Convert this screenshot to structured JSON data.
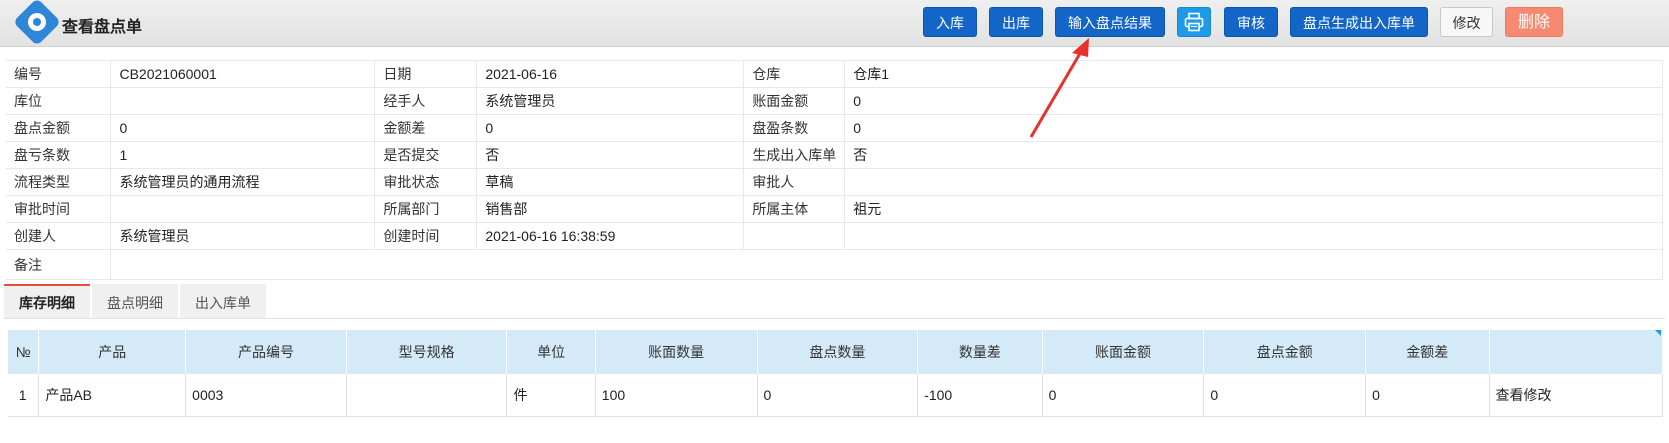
{
  "header": {
    "title": "查看盘点单",
    "buttons": {
      "in_stock": "入库",
      "out_stock": "出库",
      "input_result": "输入盘点结果",
      "audit": "审核",
      "generate": "盘点生成出入库单",
      "edit": "修改",
      "delete": "删除"
    },
    "icons": {
      "logo": "eye-logo-icon",
      "print": "printer-icon"
    },
    "colors": {
      "primary": "#1366c8",
      "print": "#1d9be8",
      "delete": "#f68a71",
      "annotation": "#e8312a"
    }
  },
  "info": {
    "rows": [
      [
        {
          "l": "编号",
          "v": "CB2021060001"
        },
        {
          "l": "日期",
          "v": "2021-06-16"
        },
        {
          "l": "仓库",
          "v": "仓库1"
        }
      ],
      [
        {
          "l": "库位",
          "v": ""
        },
        {
          "l": "经手人",
          "v": "系统管理员"
        },
        {
          "l": "账面金额",
          "v": "0"
        }
      ],
      [
        {
          "l": "盘点金额",
          "v": "0"
        },
        {
          "l": "金额差",
          "v": "0"
        },
        {
          "l": "盘盈条数",
          "v": "0"
        }
      ],
      [
        {
          "l": "盘亏条数",
          "v": "1"
        },
        {
          "l": "是否提交",
          "v": "否"
        },
        {
          "l": "生成出入库单",
          "v": "否"
        }
      ],
      [
        {
          "l": "流程类型",
          "v": "系统管理员的通用流程"
        },
        {
          "l": "审批状态",
          "v": "草稿"
        },
        {
          "l": "审批人",
          "v": ""
        }
      ],
      [
        {
          "l": "审批时间",
          "v": ""
        },
        {
          "l": "所属部门",
          "v": "销售部"
        },
        {
          "l": "所属主体",
          "v": "祖元"
        }
      ],
      [
        {
          "l": "创建人",
          "v": "系统管理员"
        },
        {
          "l": "创建时间",
          "v": "2021-06-16 16:38:59"
        },
        {
          "l": "",
          "v": ""
        }
      ]
    ],
    "remark_label": "备注",
    "remark_value": ""
  },
  "tabs": [
    "库存明细",
    "盘点明细",
    "出入库单"
  ],
  "table": {
    "columns": [
      "№",
      "产品",
      "产品编号",
      "型号规格",
      "单位",
      "账面数量",
      "盘点数量",
      "数量差",
      "账面金额",
      "盘点金额",
      "金额差",
      ""
    ],
    "rows": [
      [
        "1",
        "产品AB",
        "0003",
        "",
        "件",
        "100",
        "0",
        "-100",
        "0",
        "0",
        "0",
        "查看修改"
      ]
    ]
  }
}
